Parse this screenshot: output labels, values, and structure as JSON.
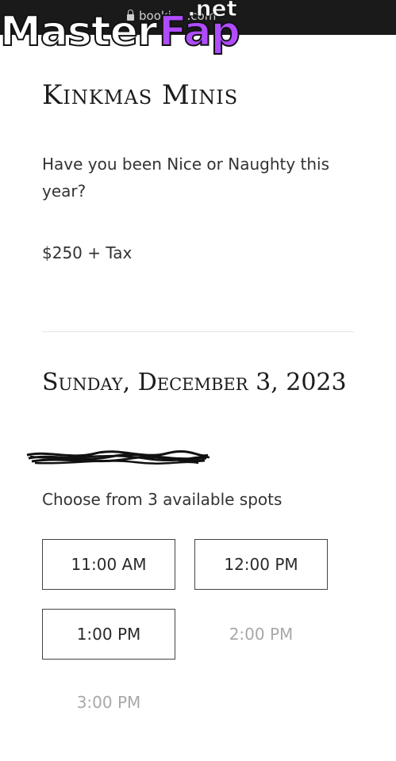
{
  "browser": {
    "url": "booki… .com"
  },
  "watermark": {
    "left": "Master",
    "right": "Fap",
    "suffix": ".net"
  },
  "event": {
    "title": "Kinkmas Minis",
    "description": "Have you been Nice or Naughty this year?",
    "price": "$250 + Tax"
  },
  "schedule": {
    "date": "Sunday, December 3, 2023",
    "availability_text": "Choose from 3 available spots",
    "slots": [
      {
        "time": "11:00 AM",
        "available": true
      },
      {
        "time": "12:00 PM",
        "available": true
      },
      {
        "time": "1:00 PM",
        "available": true
      },
      {
        "time": "2:00 PM",
        "available": false
      },
      {
        "time": "3:00 PM",
        "available": false
      }
    ]
  },
  "colors": {
    "browser_bar": "#1a1a1a",
    "available_border": "#444444",
    "unavailable_text": "#a8a8a8",
    "watermark_accent": "#b04cff"
  }
}
